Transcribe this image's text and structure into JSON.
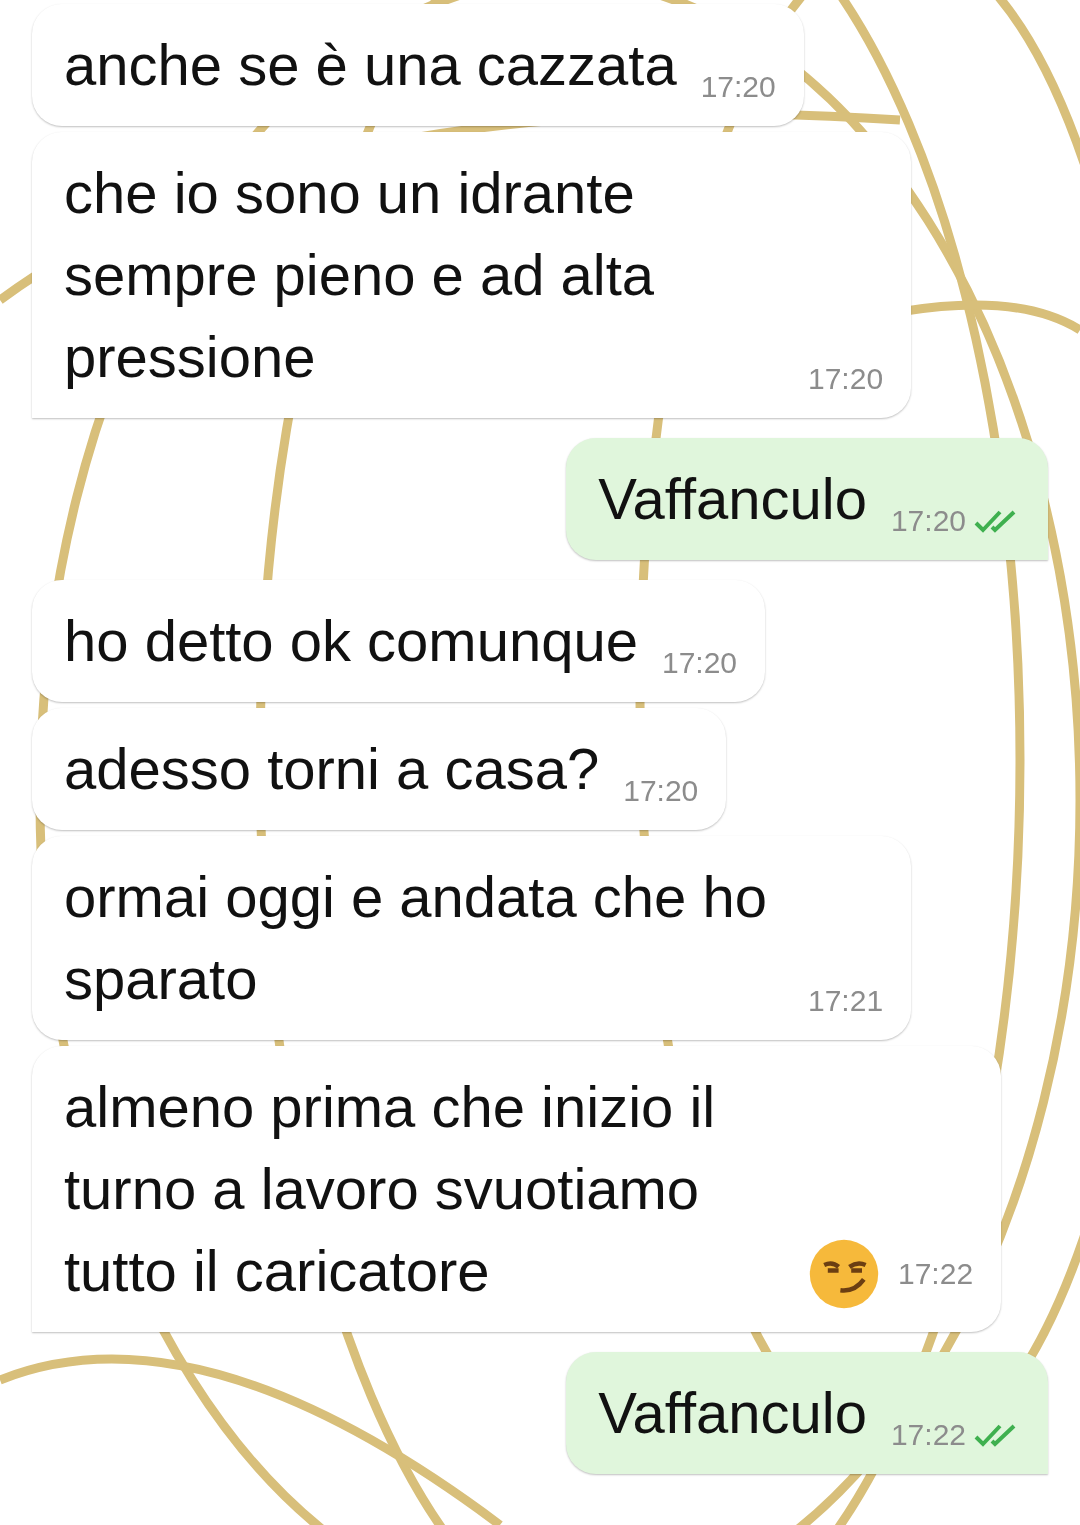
{
  "messages": [
    {
      "outgoing": false,
      "text": "anche se è una cazzata",
      "time": "17:20",
      "tail": false,
      "emoji": false
    },
    {
      "outgoing": false,
      "text": "che io sono un idrante sempre pieno e ad alta pressione",
      "time": "17:20",
      "tail": true,
      "emoji": false
    },
    {
      "outgoing": true,
      "text": "Vaffanculo",
      "time": "17:20",
      "tail": true,
      "emoji": false,
      "read": true
    },
    {
      "outgoing": false,
      "text": "ho detto ok comunque",
      "time": "17:20",
      "tail": false,
      "emoji": false
    },
    {
      "outgoing": false,
      "text": "adesso torni a casa?",
      "time": "17:20",
      "tail": false,
      "emoji": false
    },
    {
      "outgoing": false,
      "text": "ormai oggi e andata che ho sparato",
      "time": "17:21",
      "tail": false,
      "emoji": false
    },
    {
      "outgoing": false,
      "text": "almeno prima che inizio il turno a lavoro svuotiamo tutto il caricatore",
      "time": "17:22",
      "tail": true,
      "emoji": true
    },
    {
      "outgoing": true,
      "text": "Vaffanculo",
      "time": "17:22",
      "tail": true,
      "emoji": false,
      "read": true
    }
  ]
}
